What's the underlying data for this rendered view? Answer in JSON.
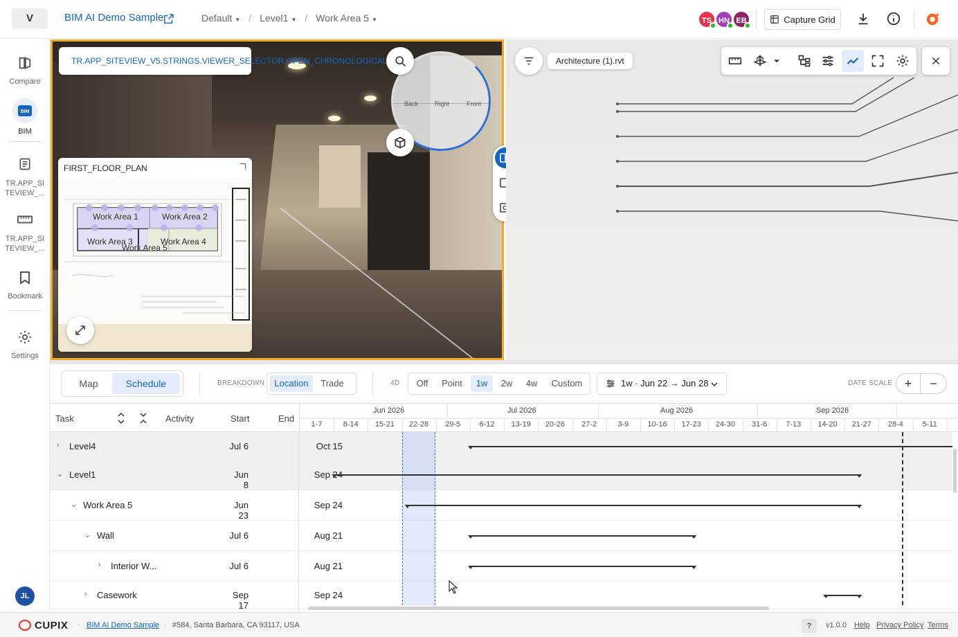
{
  "header": {
    "logo_letter": "V",
    "project_title": "BIM AI Demo Sample",
    "breadcrumbs": [
      "Default",
      "Level1",
      "Work Area 5"
    ],
    "avatars": [
      {
        "initials": "TS",
        "color": "#e2354c"
      },
      {
        "initials": "HN",
        "color": "#a23fb5"
      },
      {
        "initials": "EB",
        "color": "#8a2463"
      }
    ],
    "capture_label": "Capture Grid",
    "icons": [
      "download-icon",
      "info-icon",
      "cupix-ai-icon"
    ]
  },
  "sidebar": {
    "items": [
      {
        "label": "Compare",
        "icon": "compare-icon"
      },
      {
        "label": "BIM",
        "icon": "bim-icon",
        "active": true
      },
      {
        "label": "TR.APP_SITEVIEW_...",
        "icon": "note-icon"
      },
      {
        "label": "TR.APP_SITEVIEW_...",
        "icon": "ruler-icon"
      },
      {
        "label": "Bookmark",
        "icon": "bookmark-icon"
      },
      {
        "label": "Settings",
        "icon": "gear-icon"
      }
    ],
    "user_initials": "JL"
  },
  "viewer_left": {
    "alert_text": "TR.APP_SITEVIEW_V5.STRINGS.VIEWER_SELECTOR.OPEN_CHRONOLOGICAL",
    "orbit_labels": [
      "Back",
      "Right",
      "Front"
    ],
    "plan": {
      "title": "FIRST_FLOOR_PLAN",
      "work_areas": [
        "Work Area 1",
        "Work Area 2",
        "Work Area 3",
        "Work Area 4",
        "Work Area 5"
      ]
    }
  },
  "viewer_right": {
    "model_name": "Architecture (1).rvt"
  },
  "schedule_controls": {
    "tabs": [
      "Map",
      "Schedule"
    ],
    "active_tab": "Schedule",
    "breakdown_label": "BREAKDOWN",
    "breakdown_options": [
      "Location",
      "Trade"
    ],
    "breakdown_selected": "Location",
    "fourd_label": "4D",
    "fourd_options": [
      "Off",
      "Point",
      "1w",
      "2w",
      "4w",
      "Custom"
    ],
    "fourd_selected": "1w",
    "range_label": "1w · Jun 22 → Jun 28",
    "date_scale_label": "DATE SCALE",
    "zoom_in": "+",
    "zoom_out": "−"
  },
  "gantt": {
    "columns": {
      "task": "Task",
      "activity": "Activity",
      "start": "Start",
      "end": "End"
    },
    "months": [
      "Jun 2026",
      "Jul 2026",
      "Aug 2026",
      "Sep 2026"
    ],
    "weeks": [
      "1-7",
      "8-14",
      "15-21",
      "22-28",
      "29-5",
      "6-12",
      "13-19",
      "20-26",
      "27-2",
      "3-9",
      "10-16",
      "17-23",
      "24-30",
      "31-6",
      "7-13",
      "14-20",
      "21-27",
      "28-4",
      "5-11",
      "1"
    ],
    "rows": [
      {
        "name": "Level4",
        "start": "Jul 6",
        "end": "Oct 15",
        "chevron": "›",
        "level": 0,
        "shaded": true
      },
      {
        "name": "Level1",
        "start": "Jun 8",
        "end": "Sep 24",
        "chevron": "⌄",
        "level": 0,
        "shaded": true
      },
      {
        "name": "Work Area 5",
        "start": "Jun 23",
        "end": "Sep 24",
        "chevron": "⌄",
        "level": 1,
        "shaded": false
      },
      {
        "name": "Wall",
        "start": "Jul 6",
        "end": "Aug 21",
        "chevron": "⌄",
        "level": 2,
        "shaded": false
      },
      {
        "name": "Interior W...",
        "start": "Jul 6",
        "end": "Aug 21",
        "chevron": "›",
        "level": 3,
        "shaded": false
      },
      {
        "name": "Casework",
        "start": "Sep 17",
        "end": "Sep 24",
        "chevron": "›",
        "level": 2,
        "shaded": false
      }
    ]
  },
  "footer": {
    "brand": "CUPIX",
    "project_link": "BIM AI Demo Sample",
    "address": "#584, Santa Barbara, CA 93117, USA",
    "help_badge": "?",
    "version": "v1.0.0",
    "links": [
      "Help",
      "Privacy Policy",
      "Terms"
    ]
  }
}
